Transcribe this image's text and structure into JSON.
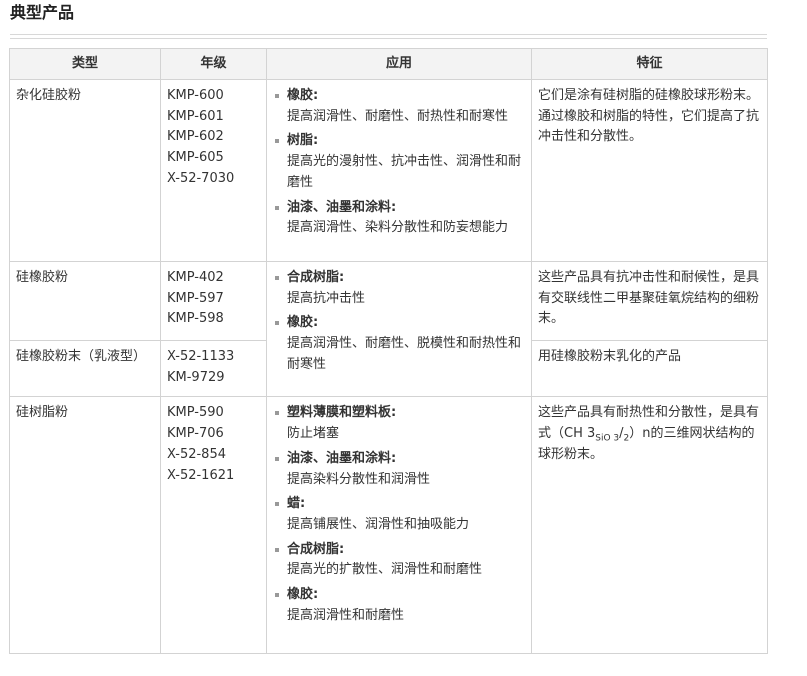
{
  "page_title": "典型产品",
  "table": {
    "headers": {
      "type": "类型",
      "grade": "年级",
      "application": "应用",
      "feature": "特征"
    },
    "rows": [
      {
        "type": "杂化硅胶粉",
        "grades": [
          "KMP-600",
          "KMP-601",
          "KMP-602",
          "KMP-605",
          "X-52-7030"
        ],
        "applications": [
          {
            "name": "橡胶:",
            "desc": "提高润滑性、耐磨性、耐热性和耐寒性"
          },
          {
            "name": "树脂:",
            "desc": "提高光的漫射性、抗冲击性、润滑性和耐磨性"
          },
          {
            "name": "油漆、油墨和涂料:",
            "desc": "提高润滑性、染料分散性和防妄想能力"
          }
        ],
        "feature": "它们是涂有硅树脂的硅橡胶球形粉末。通过橡胶和树脂的特性，它们提高了抗冲击性和分散性。"
      },
      {
        "type": "硅橡胶粉",
        "grades": [
          "KMP-402",
          "KMP-597",
          "KMP-598"
        ],
        "applications": [
          {
            "name": "合成树脂:",
            "desc": "提高抗冲击性"
          },
          {
            "name": "橡胶:",
            "desc": "提高润滑性、耐磨性、脱模性和耐热性和耐寒性"
          }
        ],
        "feature": "这些产品具有抗冲击性和耐候性，是具有交联线性二甲基聚硅氧烷结构的细粉末。"
      },
      {
        "type": "硅橡胶粉末（乳液型）",
        "grades": [
          "X-52-1133",
          "KM-9729"
        ],
        "feature": "用硅橡胶粉末乳化的产品"
      },
      {
        "type": "硅树脂粉",
        "grades": [
          "KMP-590",
          "KMP-706",
          "X-52-854",
          "X-52-1621"
        ],
        "applications": [
          {
            "name": "塑料薄膜和塑料板:",
            "desc": "防止堵塞"
          },
          {
            "name": "油漆、油墨和涂料:",
            "desc": "提高染料分散性和润滑性"
          },
          {
            "name": "蜡:",
            "desc": "提高铺展性、润滑性和抽吸能力"
          },
          {
            "name": "合成树脂:",
            "desc": "提高光的扩散性、润滑性和耐磨性"
          },
          {
            "name": "橡胶:",
            "desc": "提高润滑性和耐磨性"
          }
        ],
        "feature": {
          "before": "这些产品具有耐热性和分散性，是具有式（CH 3",
          "sub1": "SiO 3",
          "mid": "/",
          "sub2": "2",
          "after": "）n的三维网状结构的球形粉末。"
        }
      }
    ]
  }
}
